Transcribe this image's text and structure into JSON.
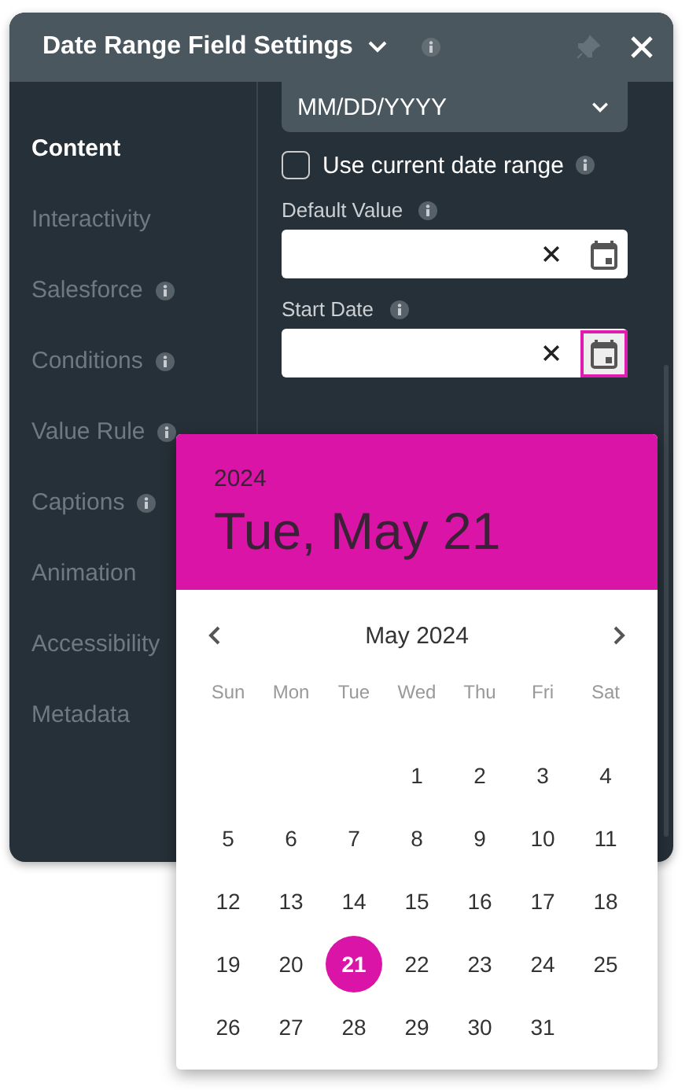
{
  "panel": {
    "title": "Date Range Field Settings"
  },
  "sidebar": {
    "items": [
      {
        "label": "Content",
        "selected": true,
        "info": false
      },
      {
        "label": "Interactivity",
        "selected": false,
        "info": false
      },
      {
        "label": "Salesforce",
        "selected": false,
        "info": true
      },
      {
        "label": "Conditions",
        "selected": false,
        "info": true
      },
      {
        "label": "Value Rule",
        "selected": false,
        "info": true
      },
      {
        "label": "Captions",
        "selected": false,
        "info": true
      },
      {
        "label": "Animation",
        "selected": false,
        "info": false
      },
      {
        "label": "Accessibility",
        "selected": false,
        "info": false
      },
      {
        "label": "Metadata",
        "selected": false,
        "info": false
      }
    ]
  },
  "content": {
    "format_select": {
      "value": "MM/DD/YYYY"
    },
    "use_current_range": {
      "label": "Use current date range",
      "checked": false
    },
    "fields": [
      {
        "label": "Default Value",
        "active": false
      },
      {
        "label": "Start Date",
        "active": true
      }
    ]
  },
  "date_picker": {
    "year": "2024",
    "date": "Tue, May 21",
    "month": "May 2024",
    "weekdays": [
      "Sun",
      "Mon",
      "Tue",
      "Wed",
      "Thu",
      "Fri",
      "Sat"
    ],
    "weeks": [
      [
        {
          "label": "1",
          "selected": false
        },
        {
          "label": "2",
          "selected": false
        },
        {
          "label": "3",
          "selected": false
        },
        {
          "label": "4",
          "selected": false
        }
      ],
      [
        {
          "label": "5",
          "selected": false
        },
        {
          "label": "6",
          "selected": false
        },
        {
          "label": "7",
          "selected": false
        },
        {
          "label": "8",
          "selected": false
        },
        {
          "label": "9",
          "selected": false
        },
        {
          "label": "10",
          "selected": false
        },
        {
          "label": "11",
          "selected": false
        }
      ],
      [
        {
          "label": "12",
          "selected": false
        },
        {
          "label": "13",
          "selected": false
        },
        {
          "label": "14",
          "selected": false
        },
        {
          "label": "15",
          "selected": false
        },
        {
          "label": "16",
          "selected": false
        },
        {
          "label": "17",
          "selected": false
        },
        {
          "label": "18",
          "selected": false
        }
      ],
      [
        {
          "label": "19",
          "selected": false
        },
        {
          "label": "20",
          "selected": false
        },
        {
          "label": "21",
          "selected": true
        },
        {
          "label": "22",
          "selected": false
        },
        {
          "label": "23",
          "selected": false
        },
        {
          "label": "24",
          "selected": false
        },
        {
          "label": "25",
          "selected": false
        }
      ],
      [
        {
          "label": "26",
          "selected": false
        },
        {
          "label": "27",
          "selected": false
        },
        {
          "label": "28",
          "selected": false
        },
        {
          "label": "29",
          "selected": false
        },
        {
          "label": "30",
          "selected": false
        },
        {
          "label": "31",
          "selected": false
        }
      ]
    ]
  }
}
